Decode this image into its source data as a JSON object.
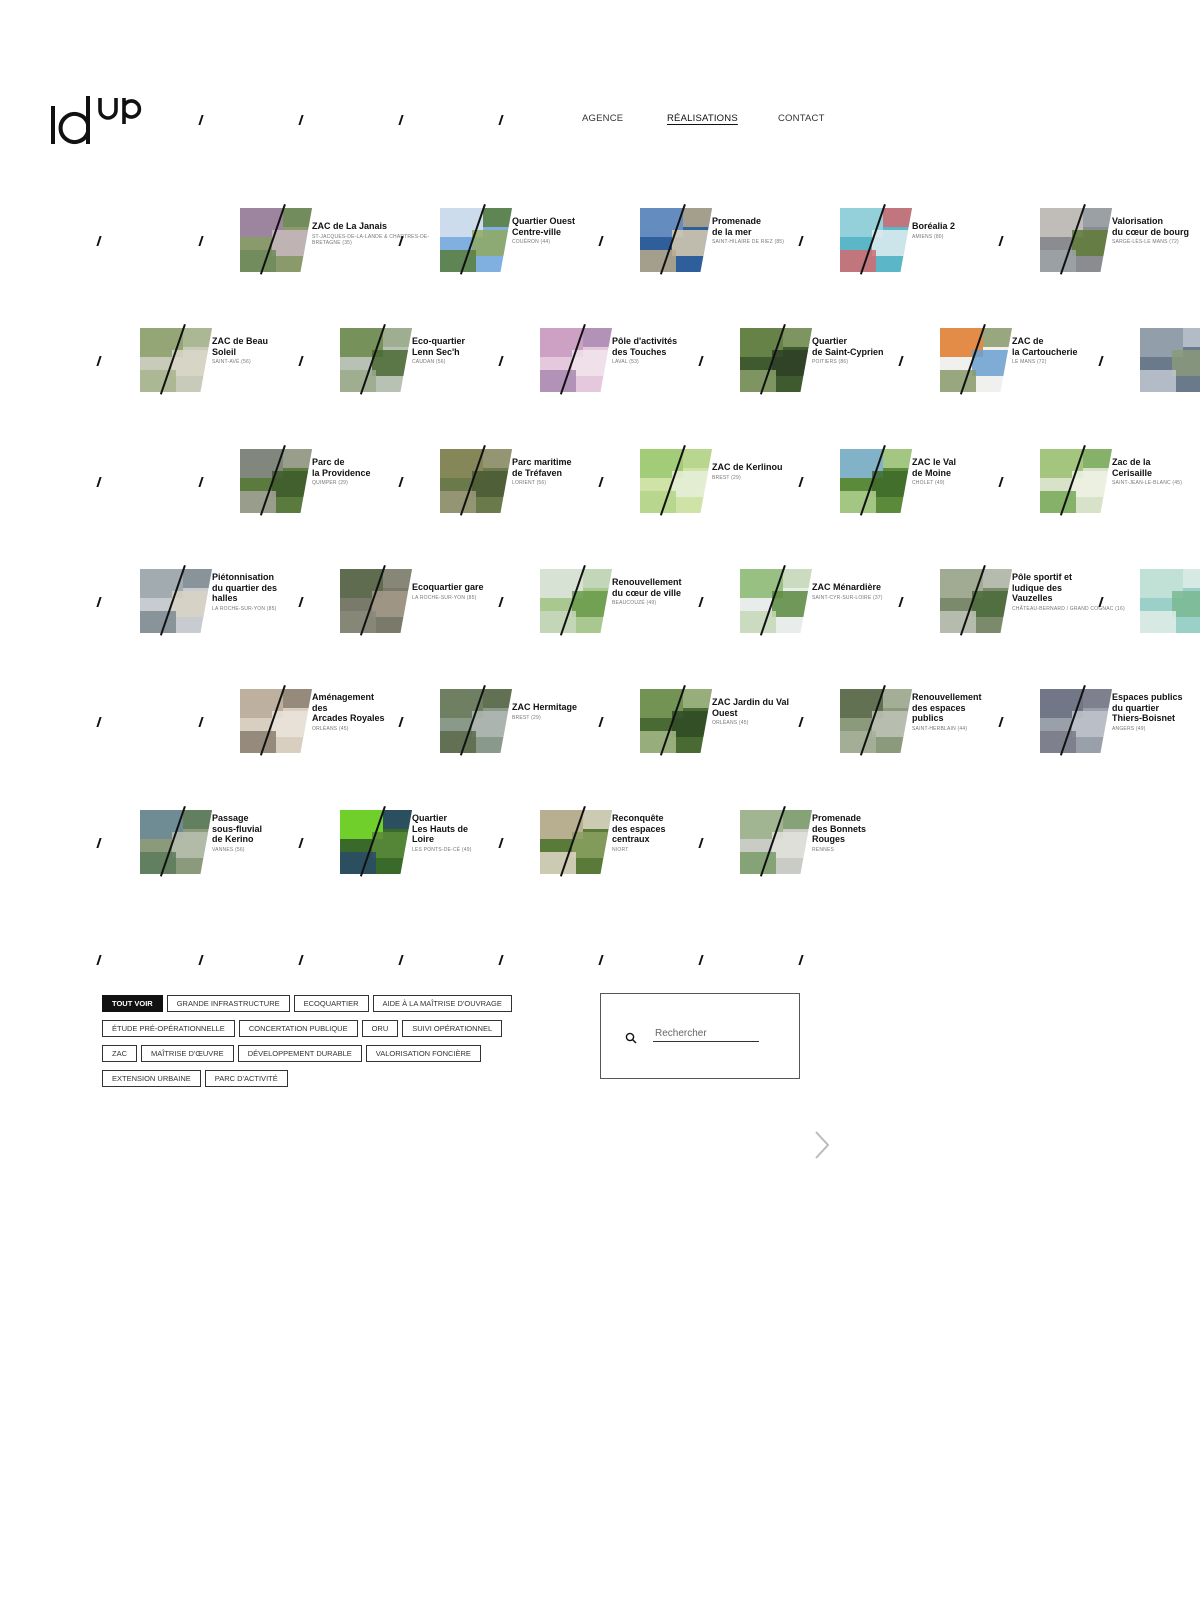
{
  "brand": {
    "logo_text": "idup"
  },
  "nav": [
    {
      "label": "AGENCE",
      "active": false
    },
    {
      "label": "RÉALISATIONS",
      "active": true
    },
    {
      "label": "CONTACT",
      "active": false
    }
  ],
  "projects": [
    {
      "title": [
        "ZAC de La Janais"
      ],
      "location": "ST-JACQUES-DE-LA-LANDE & CHARTRES-DE-BRETAGNE (35)",
      "thumb": [
        "#8a9a6a",
        "#a080a8",
        "#c8b9c0",
        "#6f8a5a"
      ]
    },
    {
      "title": [
        "Quartier Ouest",
        "Centre-ville"
      ],
      "location": "COUËRON (44)",
      "thumb": [
        "#7fb0e0",
        "#d9e4ee",
        "#8fa960",
        "#5a7e3c"
      ]
    },
    {
      "title": [
        "Promenade",
        "de la mer"
      ],
      "location": "SAINT-HILAIRE DE RIEZ (85)",
      "thumb": [
        "#2f5f9a",
        "#6d94c4",
        "#d8cbb0",
        "#b9a98a"
      ]
    },
    {
      "title": [
        "Boréalia 2"
      ],
      "location": "AMIENS (80)",
      "thumb": [
        "#5bb6c8",
        "#9fd5dc",
        "#e0edf0",
        "#d46a70"
      ]
    },
    {
      "title": [
        "Valorisation",
        "du cœur de bourg"
      ],
      "location": "SARGÉ-LÈS-LE MANS (72)",
      "thumb": [
        "#8a8c8f",
        "#c9c6c0",
        "#5f7a3a",
        "#9ea3a8"
      ]
    },
    {
      "title": [
        "ZAC de Beau",
        "Soleil"
      ],
      "location": "SAINT-AVÉ (56)",
      "thumb": [
        "#c8cbb9",
        "#8ca06a",
        "#d9d7c8",
        "#a7b48c"
      ]
    },
    {
      "title": [
        "Eco-quartier",
        "Lenn Sec'h"
      ],
      "location": "CAUDAN (56)",
      "thumb": [
        "#b8c2b4",
        "#6a8a4a",
        "#4a6a34",
        "#9aa98a"
      ]
    },
    {
      "title": [
        "Pôle d'activités",
        "des Touches"
      ],
      "location": "LAVAL (53)",
      "thumb": [
        "#e6c8dc",
        "#c89ac0",
        "#f0e4ec",
        "#a88ab0"
      ]
    },
    {
      "title": [
        "Quartier",
        "de Saint-Cyprien"
      ],
      "location": "POITIERS (86)",
      "thumb": [
        "#3f5a2f",
        "#6f8a4a",
        "#2e3f24",
        "#8aa06a"
      ]
    },
    {
      "title": [
        "ZAC de",
        "la Cartoucherie"
      ],
      "location": "LE MANS (72)",
      "thumb": [
        "#f0f0ee",
        "#e07a2a",
        "#6aa0d0",
        "#8a9a6a"
      ]
    },
    {
      "title": [
        "Parc de",
        "la Providence"
      ],
      "location": "QUIMPER (29)",
      "thumb": [
        "#5a7a3e",
        "#8a8a8a",
        "#3e5a2c",
        "#a4a49a"
      ]
    },
    {
      "title": [
        "Parc maritime",
        "de Tréfaven"
      ],
      "location": "LORIENT (56)",
      "thumb": [
        "#6a7a4a",
        "#8a8a5a",
        "#4a5a34",
        "#9a9a7a"
      ]
    },
    {
      "title": [
        "ZAC de Kerlinou"
      ],
      "location": "BREST (29)",
      "thumb": [
        "#cfe3a6",
        "#9ac870",
        "#e6efd8",
        "#b4d48a"
      ]
    },
    {
      "title": [
        "ZAC le Val",
        "de Moine"
      ],
      "location": "CHOLET (49)",
      "thumb": [
        "#5a8a3a",
        "#8ab8e0",
        "#3f6a2a",
        "#b0d090"
      ]
    },
    {
      "title": [
        "Zac de la",
        "Cerisaille"
      ],
      "location": "SAINT-JEAN-LE-BLANC (45)",
      "thumb": [
        "#d8e2c8",
        "#9ac070",
        "#eef2e4",
        "#78a858"
      ]
    },
    {
      "title": [
        "Piétonnisation",
        "du quartier des",
        "halles"
      ],
      "location": "LA ROCHE-SUR-YON (85)",
      "thumb": [
        "#c8ccd0",
        "#9aa4aa",
        "#d8d2c4",
        "#7e8a90"
      ]
    },
    {
      "title": [
        "Ecoquartier gare"
      ],
      "location": "LA ROCHE-SUR-YON (85)",
      "thumb": [
        "#7a7a6a",
        "#5a6a4a",
        "#a49a8a",
        "#8a8a7a"
      ]
    },
    {
      "title": [
        "Renouvellement",
        "du cœur de ville"
      ],
      "location": "BEAUCOUZÉ (49)",
      "thumb": [
        "#a8c890",
        "#e0e6e0",
        "#6a9a4a",
        "#c8d8c0"
      ]
    },
    {
      "title": [
        "ZAC Ménardière"
      ],
      "location": "SAINT-CYR-SUR-LOIRE (37)",
      "thumb": [
        "#e8ecea",
        "#8ab870",
        "#5a8a3e",
        "#c4d8b8"
      ]
    },
    {
      "title": [
        "Pôle sportif et",
        "ludique des",
        "Vauzelles"
      ],
      "location": "CHÂTEAU-BERNARD / GRAND COGNAC (16)",
      "thumb": [
        "#7a8a6a",
        "#a8b09a",
        "#4a6a3a",
        "#c0c4b8"
      ]
    },
    {
      "title": [
        "Aménagement",
        "des",
        "Arcades Royales"
      ],
      "location": "ORLÉANS (45)",
      "thumb": [
        "#d8cfc0",
        "#b8aa98",
        "#eae4da",
        "#8a7e70"
      ]
    },
    {
      "title": [
        "ZAC Hermitage"
      ],
      "location": "BREST (29)",
      "thumb": [
        "#8a9a8a",
        "#6a7a5a",
        "#b0b8b4",
        "#5a6a4a"
      ]
    },
    {
      "title": [
        "ZAC Jardin du Val",
        "Ouest"
      ],
      "location": "ORLÉANS (45)",
      "thumb": [
        "#4a6a34",
        "#7a9a5a",
        "#2e4a24",
        "#a4b88a"
      ]
    },
    {
      "title": [
        "Renouvellement",
        "des espaces",
        "publics"
      ],
      "location": "SAINT-HERBLAIN (44)",
      "thumb": [
        "#8a9a7a",
        "#5a6a4a",
        "#c0c4b8",
        "#a8b09a"
      ]
    },
    {
      "title": [
        "Espaces publics",
        "du quartier",
        "Thiers-Boisnet"
      ],
      "location": "ANGERS (49)",
      "thumb": [
        "#9aa0aa",
        "#6a7080",
        "#c0c4cc",
        "#7a7a8a"
      ]
    },
    {
      "title": [
        "Passage",
        "sous-fluvial",
        "de Kerino"
      ],
      "location": "VANNES (56)",
      "thumb": [
        "#8a9a7a",
        "#6a8a9a",
        "#b8c0b0",
        "#5a7a5a"
      ]
    },
    {
      "title": [
        "Quartier",
        "Les Hauts de",
        "Loire"
      ],
      "location": "LES PONTS-DE-CÉ (49)",
      "thumb": [
        "#3a6a2a",
        "#7ae02a",
        "#5a8a3a",
        "#2a4a6a"
      ]
    },
    {
      "title": [
        "Reconquête",
        "des espaces",
        "centraux"
      ],
      "location": "NIORT",
      "thumb": [
        "#5a7a3a",
        "#c8b8a0",
        "#8aa060",
        "#e0d8c8"
      ]
    },
    {
      "title": [
        "Promenade",
        "des Bonnets",
        "Rouges"
      ],
      "location": "RENNES",
      "thumb": [
        "#c8ccc4",
        "#9ab08a",
        "#e0e2dc",
        "#7a9a6a"
      ]
    }
  ],
  "partial_thumbs": [
    {
      "thumb": [
        "#6a7a8a",
        "#9aa4b0",
        "#8a9a7a",
        "#c0c8d0"
      ]
    },
    {
      "thumb": [
        "#9ad0c8",
        "#c8e4d8",
        "#7ab890",
        "#e0eee8"
      ]
    }
  ],
  "filters": [
    {
      "label": "TOUT VOIR",
      "active": true
    },
    {
      "label": "GRANDE INFRASTRUCTURE",
      "active": false
    },
    {
      "label": "ECOQUARTIER",
      "active": false
    },
    {
      "label": "AIDE À LA MAÎTRISE D'OUVRAGE",
      "active": false
    },
    {
      "label": "ÉTUDE PRÉ-OPÉRATIONNELLE",
      "active": false
    },
    {
      "label": "CONCERTATION PUBLIQUE",
      "active": false
    },
    {
      "label": "ORU",
      "active": false
    },
    {
      "label": "SUIVI OPÉRATIONNEL",
      "active": false
    },
    {
      "label": "ZAC",
      "active": false
    },
    {
      "label": "MAÎTRISE D'ŒUVRE",
      "active": false
    },
    {
      "label": "DÉVELOPPEMENT DURABLE",
      "active": false
    },
    {
      "label": "VALORISATION FONCIÈRE",
      "active": false
    },
    {
      "label": "EXTENSION URBAINE",
      "active": false
    },
    {
      "label": "PARC D'ACTIVITÉ",
      "active": false
    }
  ],
  "search": {
    "placeholder": "Rechercher",
    "value": ""
  },
  "icons": {
    "search": "search-icon",
    "next": "chevron-right-icon"
  }
}
